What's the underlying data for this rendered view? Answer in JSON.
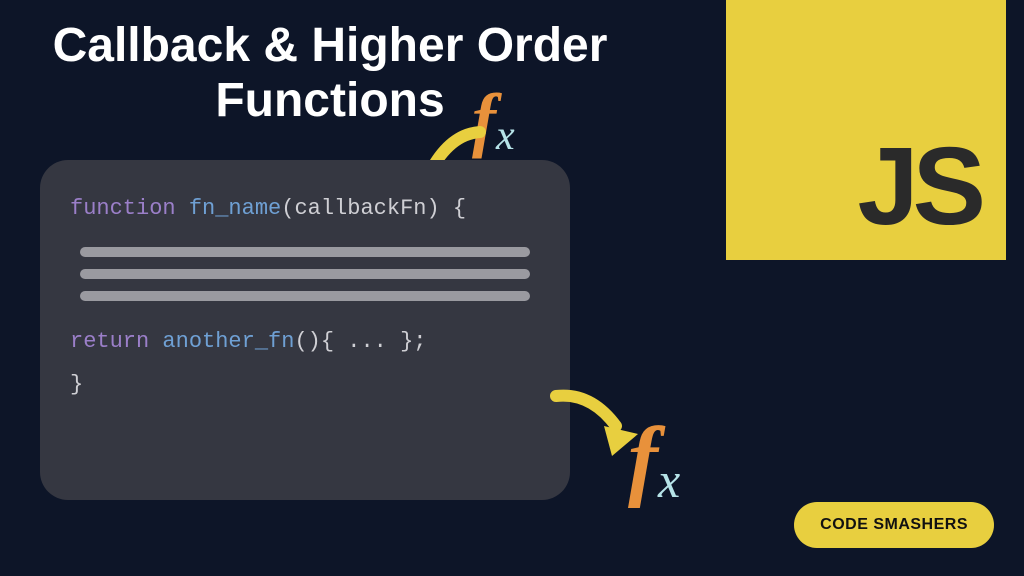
{
  "title": "Callback & Higher Order Functions",
  "js_badge": "JS",
  "fx_glyph_f": "f",
  "fx_glyph_x": "x",
  "code": {
    "kw_function": "function",
    "fn_name": "fn_name",
    "open_paren": "(",
    "param": "callbackFn",
    "close_paren": ")",
    "open_brace": "{",
    "kw_return": "return",
    "return_fn": "another_fn",
    "return_tail_open": "()",
    "return_brace_open": "{",
    "return_ellipsis": " ... ",
    "return_brace_close": "}",
    "semicolon": ";",
    "close_brace": "}"
  },
  "brand": "CODE SMASHERS"
}
